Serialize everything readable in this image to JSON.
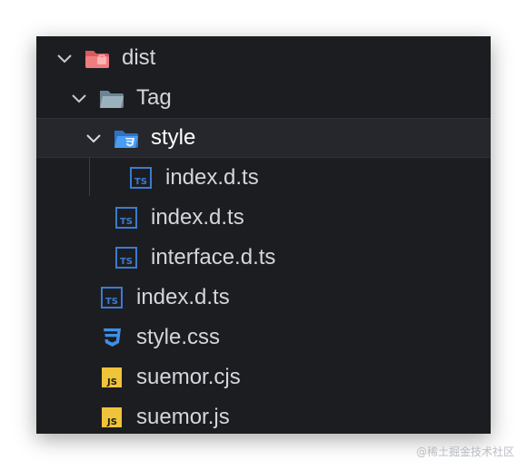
{
  "explorer": {
    "items": [
      {
        "label": "dist",
        "icon": "folder-dist-open-icon",
        "color": "#e8686a"
      },
      {
        "label": "Tag",
        "icon": "folder-open-icon",
        "color": "#8fa7b3"
      },
      {
        "label": "style",
        "icon": "folder-css-open-icon",
        "color": "#3d8fe3"
      },
      {
        "label": "index.d.ts",
        "icon": "typescript-def-file-icon",
        "color": "#3b7bd0"
      },
      {
        "label": "index.d.ts",
        "icon": "typescript-def-file-icon",
        "color": "#3b7bd0"
      },
      {
        "label": "interface.d.ts",
        "icon": "typescript-def-file-icon",
        "color": "#3b7bd0"
      },
      {
        "label": "index.d.ts",
        "icon": "typescript-def-file-icon",
        "color": "#3b7bd0"
      },
      {
        "label": "style.css",
        "icon": "css3-file-icon",
        "color": "#3f8fe6"
      },
      {
        "label": "suemor.cjs",
        "icon": "javascript-file-icon",
        "color": "#f0c43a"
      },
      {
        "label": "suemor.js",
        "icon": "javascript-file-icon",
        "color": "#f0c43a"
      }
    ],
    "selected": "style"
  },
  "watermark": "@稀土掘金技术社区"
}
